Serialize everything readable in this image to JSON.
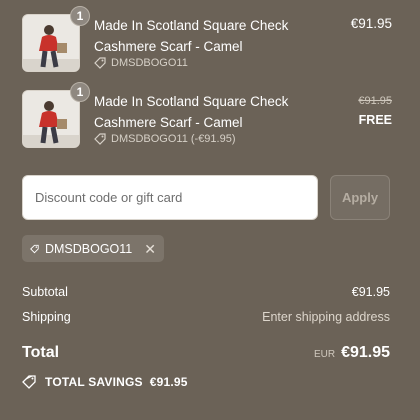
{
  "items": [
    {
      "quantity": "1",
      "title": "Made In Scotland Square Check Cashmere Scarf - Camel",
      "discount": "DMSDBOGO11",
      "price": "€91.95"
    },
    {
      "quantity": "1",
      "title": "Made In Scotland Square Check Cashmere Scarf - Camel",
      "discount": "DMSDBOGO11 (-€91.95)",
      "original_price": "€91.95",
      "price": "FREE"
    }
  ],
  "discount_form": {
    "placeholder": "Discount code or gift card",
    "apply_label": "Apply"
  },
  "applied_code": {
    "code": "DMSDBOGO11"
  },
  "summary": {
    "subtotal_label": "Subtotal",
    "subtotal_value": "€91.95",
    "shipping_label": "Shipping",
    "shipping_value": "Enter shipping address",
    "total_label": "Total",
    "currency": "EUR",
    "total_value": "€91.95",
    "savings_label": "TOTAL SAVINGS",
    "savings_value": "€91.95"
  },
  "colors": {
    "background": "#6b6257",
    "text": "#ffffff",
    "muted": "#ddd6cc",
    "input_bg": "#ffffff"
  },
  "icons": [
    "tag-icon",
    "close-icon",
    "savings-tag-icon"
  ]
}
